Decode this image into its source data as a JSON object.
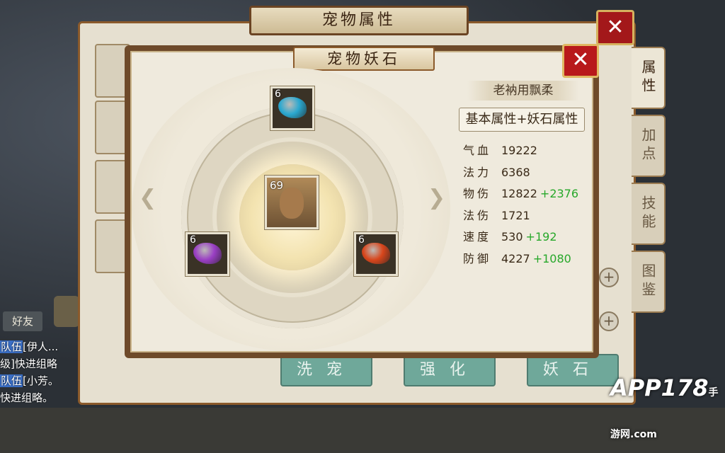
{
  "outer_panel": {
    "title": "宠物属性",
    "close_glyph": "✕",
    "side_tabs": [
      "属性",
      "加点",
      "技能",
      "图鉴"
    ],
    "bottom_buttons": [
      "洗宠",
      "强化",
      "妖石"
    ]
  },
  "dialog": {
    "title": "宠物妖石",
    "close_glyph": "✕",
    "pet_level": "69",
    "stones": [
      {
        "position": "top",
        "level": "6",
        "color": "#2aa8d0"
      },
      {
        "position": "left",
        "level": "6",
        "color": "#9a3fc4"
      },
      {
        "position": "right",
        "level": "6",
        "color": "#d8461c"
      }
    ],
    "pet_name": "老衲用飘柔",
    "subtitle": "基本属性+妖石属性",
    "stats": [
      {
        "label": "气血",
        "value": "19222",
        "bonus": ""
      },
      {
        "label": "法力",
        "value": "6368",
        "bonus": ""
      },
      {
        "label": "物伤",
        "value": "12822",
        "bonus": "+2376"
      },
      {
        "label": "法伤",
        "value": "1721",
        "bonus": ""
      },
      {
        "label": "速度",
        "value": "530",
        "bonus": "+192"
      },
      {
        "label": "防御",
        "value": "4227",
        "bonus": "+1080"
      }
    ]
  },
  "chat": {
    "friend_button": "好友",
    "lines": [
      {
        "tag": "队伍",
        "text": "[伊人..."
      },
      {
        "tag": "",
        "text": "级]快进组略"
      },
      {
        "tag": "队伍",
        "text": "[小芳。"
      },
      {
        "tag": "",
        "text": "快进组略。"
      }
    ]
  },
  "watermark": {
    "text": "APP178",
    "sub": "手游网",
    "domain": ".com"
  }
}
